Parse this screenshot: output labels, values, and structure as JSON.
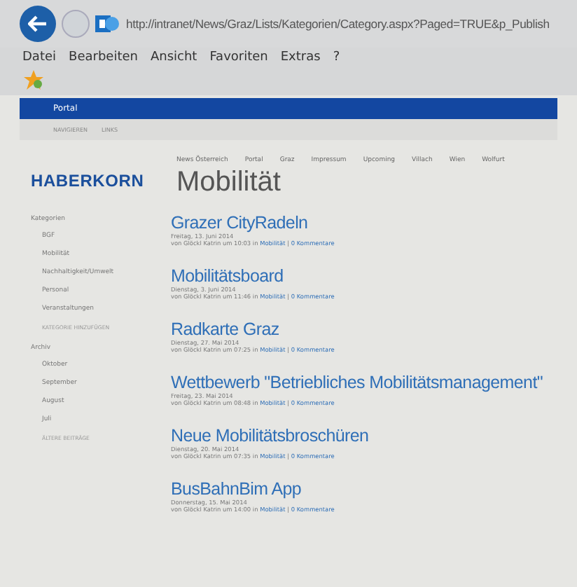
{
  "browser": {
    "url": "http://intranet/News/Graz/Lists/Kategorien/Category.aspx?Paged=TRUE&p_Publish",
    "menu": [
      "Datei",
      "Bearbeiten",
      "Ansicht",
      "Favoriten",
      "Extras",
      "?"
    ]
  },
  "suite_bar": {
    "title": "Portal"
  },
  "ribbon": [
    "NAVIGIEREN",
    "LINKS"
  ],
  "logo": "HABERKORN",
  "top_nav": [
    "News Österreich",
    "Portal",
    "Graz",
    "Impressum",
    "Upcoming",
    "Villach",
    "Wien",
    "Wolfurt"
  ],
  "page_title": "Mobilität",
  "sidebar": [
    {
      "heading": "Kategorien",
      "items": [
        "BGF",
        "Mobilität",
        "Nachhaltigkeit/Umwelt",
        "Personal",
        "Veranstaltungen"
      ],
      "action": "KATEGORIE HINZUFÜGEN"
    },
    {
      "heading": "Archiv",
      "items": [
        "Oktober",
        "September",
        "August",
        "Juli"
      ],
      "action": "ÄLTERE BEITRÄGE"
    }
  ],
  "separator": "|",
  "posts": [
    {
      "title": "Grazer CityRadeln",
      "date": "Freitag, 13. Juni 2014",
      "byline": "von Glöckl Katrin um 10:03 in ",
      "category": "Mobilität",
      "comments": "0 Kommentare"
    },
    {
      "title": "Mobilitätsboard",
      "date": "Dienstag, 3. Juni 2014",
      "byline": "von Glöckl Katrin um 11:46 in ",
      "category": "Mobilität",
      "comments": "0 Kommentare"
    },
    {
      "title": "Radkarte Graz",
      "date": "Dienstag, 27. Mai 2014",
      "byline": "von Glöckl Katrin um 07:25 in ",
      "category": "Mobilität",
      "comments": "0 Kommentare"
    },
    {
      "title": "Wettbewerb \"Betriebliches Mobilitätsmanagement\"",
      "date": "Freitag, 23. Mai 2014",
      "byline": "von Glöckl Katrin um 08:48 in ",
      "category": "Mobilität",
      "comments": "0 Kommentare"
    },
    {
      "title": "Neue Mobilitätsbroschüren",
      "date": "Dienstag, 20. Mai 2014",
      "byline": "von Glöckl Katrin um 07:35 in ",
      "category": "Mobilität",
      "comments": "0 Kommentare"
    },
    {
      "title": "BusBahnBim App",
      "date": "Donnerstag, 15. Mai 2014",
      "byline": "von Glöckl Katrin um 14:00 in ",
      "category": "Mobilität",
      "comments": "0 Kommentare"
    }
  ]
}
